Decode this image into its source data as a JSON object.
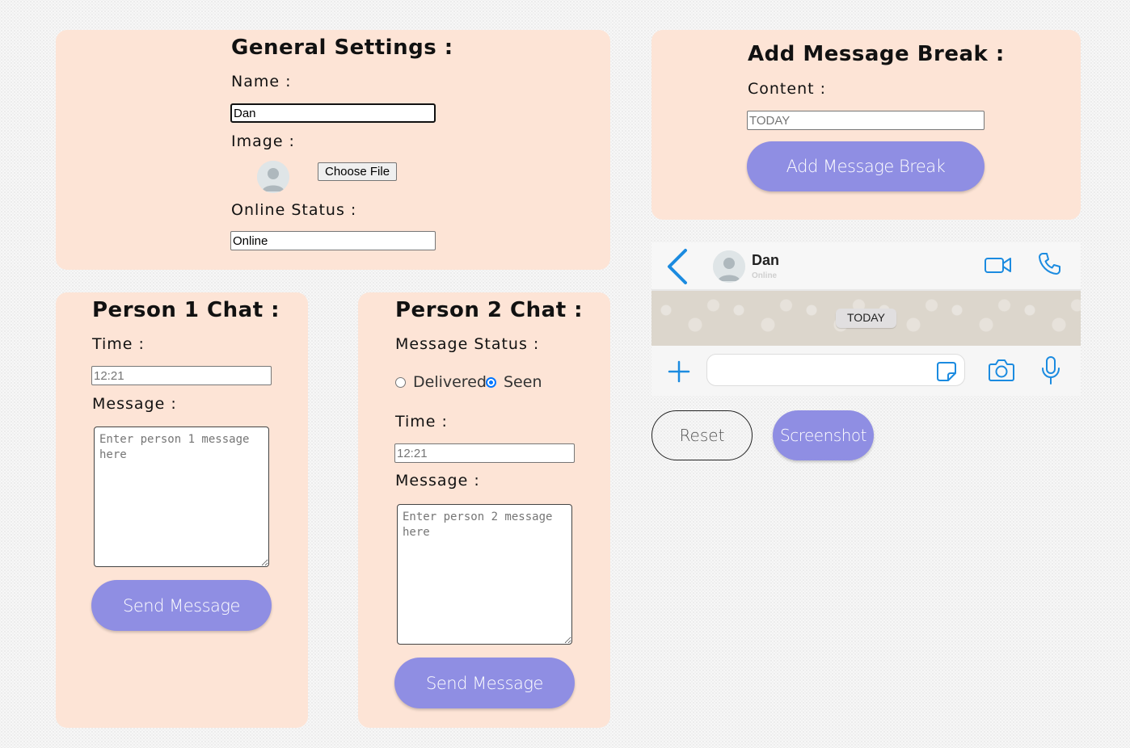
{
  "general_settings": {
    "title": "General Settings :",
    "name_label": "Name :",
    "name_value": "Dan",
    "image_label": "Image :",
    "choose_file_label": "Choose File",
    "online_status_label": "Online Status :",
    "online_status_value": "Online"
  },
  "message_break": {
    "title": "Add Message Break :",
    "content_label": "Content :",
    "content_placeholder": "TODAY",
    "button_label": "Add Message Break"
  },
  "person1": {
    "title": "Person 1 Chat :",
    "time_label": "Time :",
    "time_placeholder": "12:21",
    "message_label": "Message :",
    "message_placeholder": "Enter person 1 message here",
    "send_label": "Send Message"
  },
  "person2": {
    "title": "Person 2 Chat :",
    "status_label": "Message Status :",
    "status_options": [
      "Delivered",
      "Seen"
    ],
    "status_selected": "Seen",
    "time_label": "Time :",
    "time_placeholder": "12:21",
    "message_label": "Message :",
    "message_placeholder": "Enter person 2 message here",
    "send_label": "Send Message"
  },
  "preview": {
    "contact_name": "Dan",
    "contact_status": "Online",
    "break_text": "TODAY"
  },
  "actions": {
    "reset_label": "Reset",
    "screenshot_label": "Screenshot"
  },
  "colors": {
    "panel_bg": "#fde4d6",
    "accent": "#8f8ee3",
    "icon_blue": "#1b8be0"
  }
}
